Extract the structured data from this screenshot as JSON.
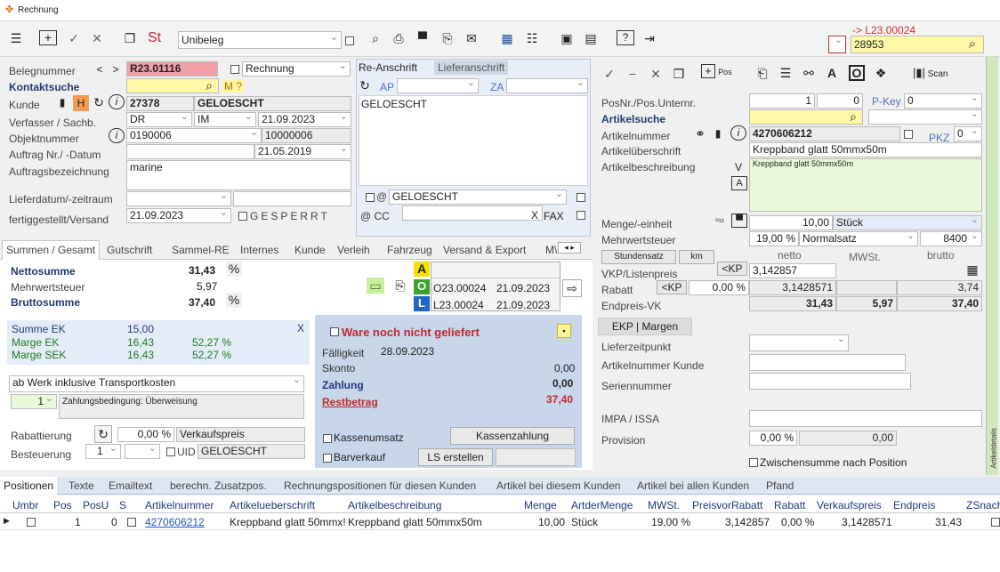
{
  "window": {
    "title": "Rechnung"
  },
  "toolbar": {
    "mode_select": "Unibeleg",
    "st_label": "St",
    "target_label": "-> L23.00024",
    "search_value": "28953"
  },
  "left": {
    "belegnummer_label": "Belegnummer",
    "belegnummer_value": "R23.01116",
    "rechnung_label": "Rechnung",
    "kontaktsuche_label": "Kontaktsuche",
    "m_label": "M ?",
    "kunde_label": "Kunde",
    "kunde_h": "H",
    "kunde_nr": "27378",
    "kunde_name": "GELOESCHT",
    "verfasser_label": "Verfasser / Sachb.",
    "verfasser_value": "DR",
    "sachb_value": "IM",
    "verfasser_date": "21.09.2023",
    "objekt_label": "Objektnummer",
    "objekt_value": "0190006",
    "objekt_value2": "10000006",
    "auftrag_label": "Auftrag Nr./ -Datum",
    "auftrag_date": "21.05.2019",
    "auftragsbez_label": "Auftragsbezeichnung",
    "auftragsbez_value": "marine",
    "lieferdatum_label": "Lieferdatum/-zeitraum",
    "fertig_label": "fertiggestellt/Versand",
    "fertig_date": "21.09.2023",
    "gesperrt_label": "GESPERRT"
  },
  "address": {
    "tabs": [
      "Re-Anschrift",
      "Lieferanschrift"
    ],
    "ap_label": "AP",
    "za_label": "ZA",
    "content": "GELOESCHT",
    "email_value": "GELOESCHT",
    "cc_label": "@ CC",
    "x_label": "X",
    "fax_label": "FAX"
  },
  "sumtabs": [
    "Summen / Gesamt",
    "Gutschrift",
    "Sammel-RE",
    "Internes",
    "Kunde",
    "Verleih",
    "Fahrzeug",
    "Versand & Export",
    "M\\"
  ],
  "sums": {
    "netto_label": "Nettosumme",
    "netto_value": "31,43",
    "mwst_label": "Mehrwertsteuer",
    "mwst_value": "5,97",
    "brutto_label": "Bruttosumme",
    "brutto_value": "37,40",
    "pct": "%"
  },
  "docs": {
    "a": "A",
    "o": "O",
    "l": "L",
    "rows": [
      {
        "nr": "O23.00024",
        "date": "21.09.2023"
      },
      {
        "nr": "L23.00024",
        "date": "21.09.2023"
      }
    ]
  },
  "ek": {
    "summe_label": "Summe EK",
    "summe_value": "15,00",
    "marge_label": "Marge EK",
    "marge_value": "16,43",
    "marge_pct": "52,27 %",
    "sek_label": "Marge SEK",
    "sek_value": "16,43",
    "sek_pct": "52,27 %",
    "close": "X"
  },
  "payment": {
    "lieferbed": "ab Werk inklusive Transportkosten",
    "zb_nr": "1",
    "zb_text": "Zahlungsbedingung: Überweisung",
    "rabatt_label": "Rabattierung",
    "rabatt_value": "0,00 %",
    "rabatt_type": "Verkaufspreis",
    "besteuerung_label": "Besteuerung",
    "besteuerung_value": "1",
    "uid_label": "UID",
    "uid_value": "GELOESCHT"
  },
  "status": {
    "ware_label": "Ware noch nicht geliefert",
    "faellig_label": "Fälligkeit",
    "faellig_value": "28.09.2023",
    "skonto_label": "Skonto",
    "skonto_value": "0,00",
    "zahlung_label": "Zahlung",
    "zahlung_value": "0,00",
    "rest_label": "Restbetrag",
    "rest_value": "37,40",
    "kassenumsatz_label": "Kassenumsatz",
    "kassenzahlung_label": "Kassenzahlung",
    "barverkauf_label": "Barverkauf",
    "ls_label": "LS erstellen"
  },
  "position": {
    "pos_label": "PosNr./Pos.Unternr.",
    "pos_value": "1",
    "unter_value": "0",
    "pkey_label": "P-Key",
    "pkey_value": "0",
    "artikelsuche_label": "Artikelsuche",
    "artikelnummer_label": "Artikelnummer",
    "artikelnummer_value": "4270606212",
    "pkz_label": "PKZ",
    "pkz_value": "0",
    "ueberschrift_label": "Artikelüberschrift",
    "ueberschrift_value": "Kreppband glatt 50mmx50m",
    "beschreibung_label": "Artikelbeschreibung",
    "beschreibung_value": "Kreppband glatt 50mmx50m",
    "v_label": "V",
    "pos_btn": "Pos",
    "scan_btn": "Scan"
  },
  "pricing": {
    "menge_label": "Menge/-einheit",
    "menge_value": "10,00",
    "einheit": "Stück",
    "mwst_label": "Mehrwertsteuer",
    "mwst_pct": "19,00 %",
    "mwst_type": "Normalsatz",
    "mwst_code": "8400",
    "stundensatz": "Stundensatz",
    "km": "km",
    "netto_h": "netto",
    "mwst_h": "MWSt.",
    "brutto_h": "brutto",
    "kp_btn": "<KP",
    "vkp_label": "VKP/Listenpreis",
    "vkp_value": "3,142857",
    "rabatt_label": "Rabatt",
    "rabatt_pct": "0,00 %",
    "rabatt_netto": "3,1428571",
    "rabatt_brutto": "3,74",
    "endpreis_label": "Endpreis-VK",
    "endpreis_netto": "31,43",
    "endpreis_mwst": "5,97",
    "endpreis_brutto": "37,40",
    "ekp_btn": "EKP | Margen",
    "lieferzeit_label": "Lieferzeitpunkt",
    "artkunde_label": "Artikelnummer Kunde",
    "serien_label": "Seriennummer",
    "impa_label": "IMPA / ISSA",
    "provision_label": "Provision",
    "provision_pct": "0,00 %",
    "provision_value": "0,00",
    "zwischen_label": "Zwischensumme nach Position",
    "side_label": "Artikeldetails"
  },
  "bottomtabs": [
    "Positionen",
    "Texte",
    "Emailtext",
    "berechn. Zusatzpos.",
    "Rechnungspositionen für diesen Kunden",
    "Artikel bei diesem Kunden",
    "Artikel bei allen Kunden",
    "Pfand"
  ],
  "table": {
    "headers": [
      "Umbr",
      "Pos",
      "PosU",
      "S",
      "Artikelnummer",
      "Artikelueberschrift",
      "Artikelbeschreibung",
      "Menge",
      "ArtderMenge",
      "MWSt.",
      "PreisvorRabatt",
      "Rabatt",
      "Verkaufspreis",
      "Endpreis",
      "ZSnach"
    ],
    "rows": [
      {
        "pos": "1",
        "posu": "0",
        "artnr": "4270606212",
        "ueb": "Kreppband glatt 50mmx!",
        "beschr": "Kreppband glatt 50mmx50m",
        "menge": "10,00",
        "art": "Stück",
        "mwst": "19,00 %",
        "pvr": "3,142857",
        "rabatt": "0,00 %",
        "vk": "3,1428571",
        "end": "31,43"
      }
    ]
  }
}
